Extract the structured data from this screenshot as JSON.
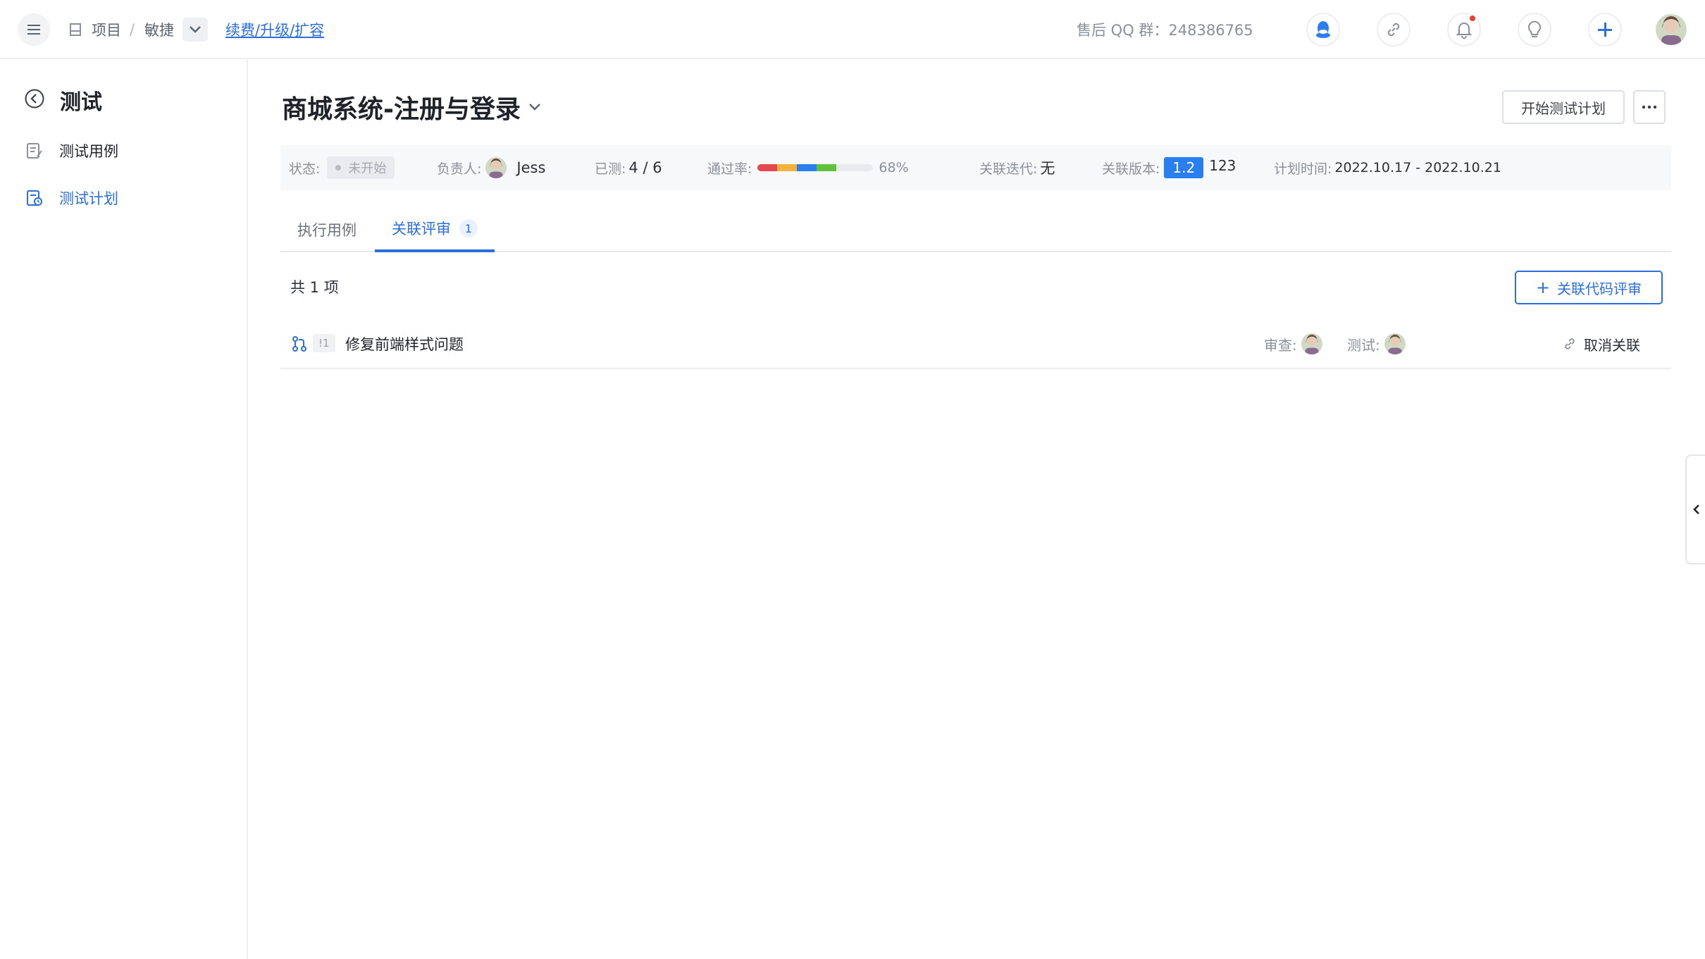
{
  "header": {
    "breadcrumb": {
      "project": "项目",
      "separator": "/",
      "current": "敏捷"
    },
    "renew_link": "续费/升级/扩容",
    "support_qq": "售后 QQ 群：248386765",
    "icons": [
      "qq-icon",
      "link-icon",
      "bell-icon",
      "lightbulb-icon",
      "plus-icon"
    ],
    "accent_color": "#2a6fdb"
  },
  "sidebar": {
    "title": "测试",
    "items": [
      {
        "label": "测试用例",
        "icon": "test-case-icon",
        "active": false
      },
      {
        "label": "测试计划",
        "icon": "test-plan-icon",
        "active": true
      }
    ]
  },
  "plan": {
    "title": "商城系统-注册与登录",
    "start_button": "开始测试计划",
    "info": {
      "status_label": "状态:",
      "status_value": "未开始",
      "owner_label": "负责人:",
      "owner_name": "Jess",
      "tested_label": "已测:",
      "tested_value": "4 / 6",
      "pass_label": "通过率:",
      "pass_rate": 68,
      "pass_rate_text": "68%",
      "pass_colors": [
        "#e5484d",
        "#f2b33d",
        "#2a7ff0",
        "#5fc23a"
      ],
      "iteration_label": "关联迭代:",
      "iteration_value": "无",
      "version_label": "关联版本:",
      "version_tag": "1.2",
      "version_name": "123",
      "time_label": "计划时间:",
      "time_value": "2022.10.17 - 2022.10.21"
    }
  },
  "tabs": [
    {
      "label": "执行用例",
      "active": false
    },
    {
      "label": "关联评审",
      "active": true,
      "badge": "1"
    }
  ],
  "reviews": {
    "total": "共 1 项",
    "link_button": "关联代码评审",
    "rows": [
      {
        "id": "!1",
        "title": "修复前端样式问题",
        "reviewer_label": "审查:",
        "tester_label": "测试:",
        "unlink": "取消关联"
      }
    ]
  }
}
